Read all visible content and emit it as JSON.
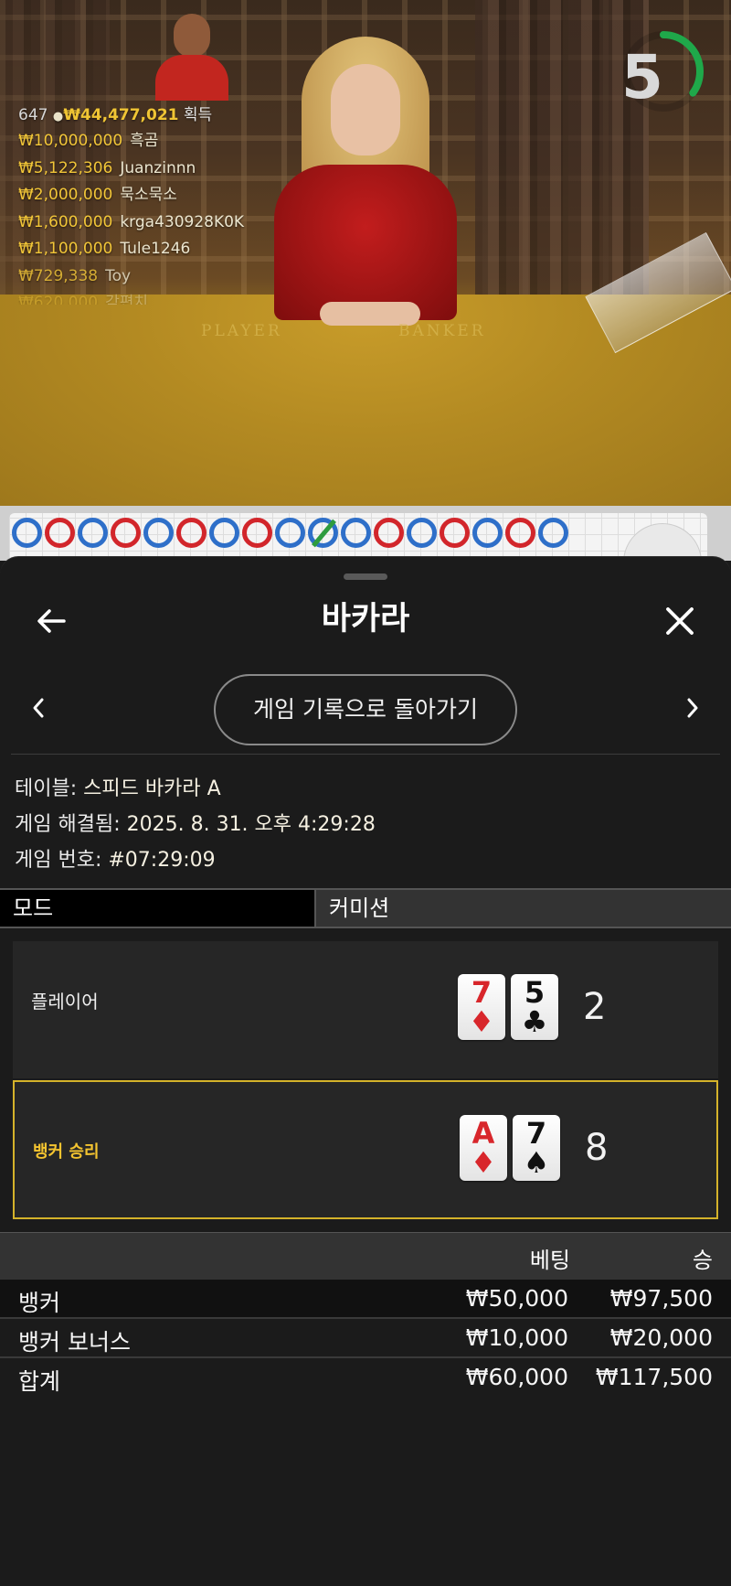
{
  "video": {
    "table_labels": [
      "PLAYER",
      "BANKER"
    ],
    "timer_value": "5",
    "timer_fraction": 0.35,
    "timer_color": "#1fa84a",
    "winners": {
      "count": "647",
      "person_icon": "person-icon",
      "total": "₩44,477,021",
      "suffix": "획득",
      "list": [
        {
          "amount": "₩10,000,000",
          "name": "흑곰"
        },
        {
          "amount": "₩5,122,306",
          "name": "Juanzinnn"
        },
        {
          "amount": "₩2,000,000",
          "name": "묵소묵소"
        },
        {
          "amount": "₩1,600,000",
          "name": "krga430928K0K"
        },
        {
          "amount": "₩1,100,000",
          "name": "Tule1246"
        },
        {
          "amount": "₩729,338",
          "name": "Toy"
        },
        {
          "amount": "₩620,000",
          "name": "각편치"
        }
      ]
    }
  },
  "road": {
    "results": [
      "P",
      "B",
      "P",
      "B",
      "P",
      "B",
      "P",
      "B",
      "P",
      "T",
      "P",
      "B",
      "P",
      "B",
      "P",
      "B",
      "P"
    ],
    "player_color": "#2e6fc9",
    "banker_color": "#d2262b",
    "tie_color": "#2e9c3f"
  },
  "sheet": {
    "title": "바카라",
    "back_icon": "arrow-left-icon",
    "close_icon": "close-icon",
    "history_button": "게임 기록으로 돌아가기",
    "info": {
      "table_label": "테이블:",
      "table_value": "스피드 바카라 A",
      "resolved_label": "게임 해결됨:",
      "resolved_value": "2025. 8. 31. 오후 4:29:28",
      "number_label": "게임 번호:",
      "number_value": "#07:29:09"
    },
    "mode": {
      "mode_label": "모드",
      "mode_value": "커미션"
    },
    "player": {
      "label": "플레이어",
      "cards": [
        {
          "rank": "7",
          "suit": "♦",
          "color": "red"
        },
        {
          "rank": "5",
          "suit": "♣",
          "color": "black"
        }
      ],
      "score": "2"
    },
    "banker": {
      "label": "뱅커 승리",
      "cards": [
        {
          "rank": "A",
          "suit": "♦",
          "color": "red"
        },
        {
          "rank": "7",
          "suit": "♠",
          "color": "black"
        }
      ],
      "score": "8"
    },
    "bets": {
      "bet_header": "베팅",
      "win_header": "승",
      "rows": [
        {
          "name": "뱅커",
          "bet": "₩50,000",
          "win": "₩97,500"
        },
        {
          "name": "뱅커 보너스",
          "bet": "₩10,000",
          "win": "₩20,000"
        },
        {
          "name": "합계",
          "bet": "₩60,000",
          "win": "₩117,500"
        }
      ]
    },
    "accent_color": "#d4b22a"
  }
}
